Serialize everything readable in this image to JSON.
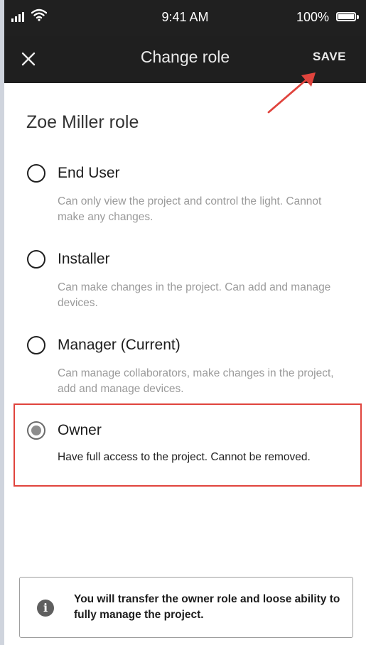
{
  "status_bar": {
    "time": "9:41 AM",
    "battery": "100%",
    "icons": [
      "signal-icon",
      "wifi-icon",
      "battery-icon"
    ]
  },
  "app_bar": {
    "close_icon": "close-icon",
    "title": "Change role",
    "save_label": "SAVE"
  },
  "role_section": {
    "title": "Zoe Miller role",
    "options": [
      {
        "label": "End User",
        "description": "Can only view the project and control the light. Cannot make any changes.",
        "selected": false
      },
      {
        "label": "Installer",
        "description": "Can make changes in the project. Can add and manage devices.",
        "selected": false
      },
      {
        "label": "Manager (Current)",
        "description": "Can manage collaborators, make changes in the project, add and manage devices.",
        "selected": false
      },
      {
        "label": "Owner",
        "description": "Have full access to the project. Cannot be removed.",
        "selected": true
      }
    ]
  },
  "info_banner": {
    "icon": "info-icon",
    "text": "You will transfer the owner role and loose ability to fully manage the project."
  },
  "annotations": {
    "accent_color": "#e0443d"
  }
}
